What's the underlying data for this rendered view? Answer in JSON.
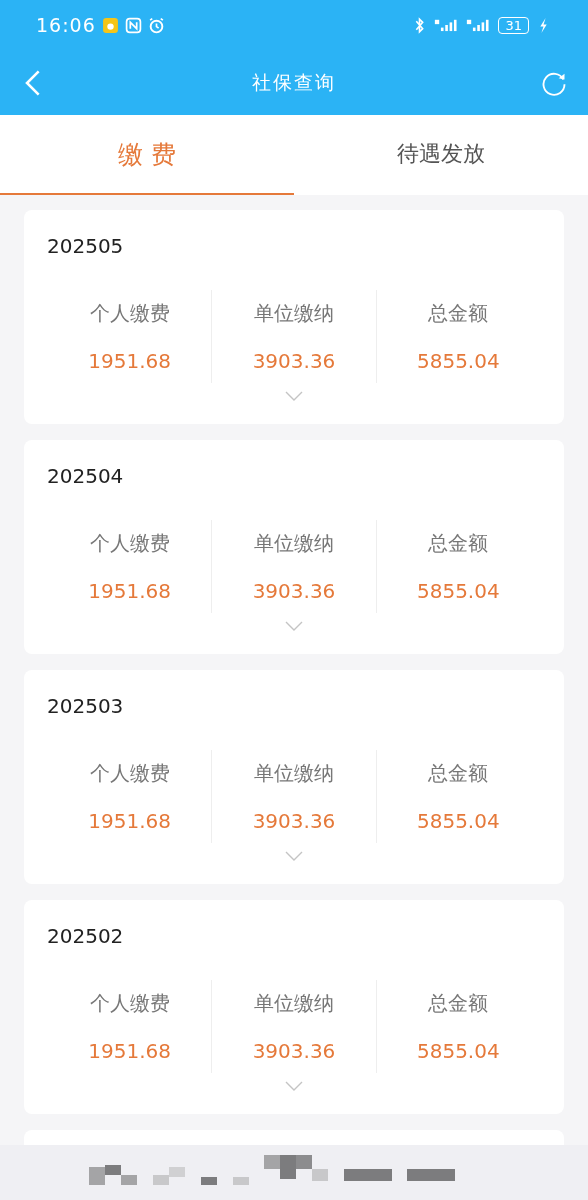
{
  "status_bar": {
    "time": "16:06",
    "battery": "31"
  },
  "header": {
    "title": "社保查询"
  },
  "tabs": [
    {
      "label": "缴 费",
      "selected": true
    },
    {
      "label": "待遇发放",
      "selected": false
    }
  ],
  "records": [
    {
      "month": "202505",
      "items": [
        {
          "label": "个人缴费",
          "value": "1951.68"
        },
        {
          "label": "单位缴纳",
          "value": "3903.36"
        },
        {
          "label": "总金额",
          "value": "5855.04"
        }
      ]
    },
    {
      "month": "202504",
      "items": [
        {
          "label": "个人缴费",
          "value": "1951.68"
        },
        {
          "label": "单位缴纳",
          "value": "3903.36"
        },
        {
          "label": "总金额",
          "value": "5855.04"
        }
      ]
    },
    {
      "month": "202503",
      "items": [
        {
          "label": "个人缴费",
          "value": "1951.68"
        },
        {
          "label": "单位缴纳",
          "value": "3903.36"
        },
        {
          "label": "总金额",
          "value": "5855.04"
        }
      ]
    },
    {
      "month": "202502",
      "items": [
        {
          "label": "个人缴费",
          "value": "1951.68"
        },
        {
          "label": "单位缴纳",
          "value": "3903.36"
        },
        {
          "label": "总金额",
          "value": "5855.04"
        }
      ]
    }
  ]
}
